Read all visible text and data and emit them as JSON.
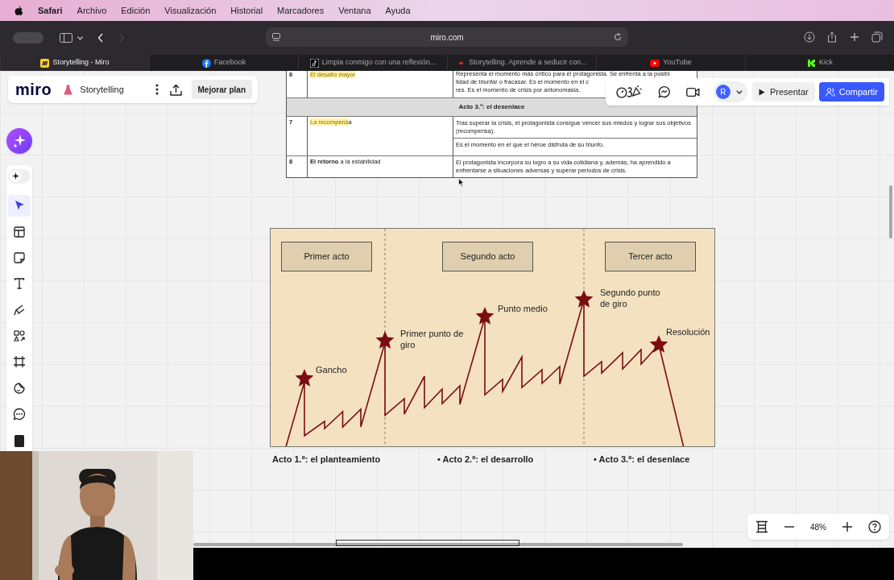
{
  "menu_bar": {
    "app": "Safari",
    "items": [
      "Archivo",
      "Edición",
      "Visualización",
      "Historial",
      "Marcadores",
      "Ventana",
      "Ayuda"
    ]
  },
  "browser": {
    "address": "miro.com",
    "nav": [
      {
        "kind": "back",
        "disabled": false
      },
      {
        "kind": "forward",
        "disabled": true
      }
    ]
  },
  "tabs": [
    {
      "kind": "miro",
      "label": "Storytelling - Miro",
      "selected": true
    },
    {
      "kind": "facebook",
      "label": "Facebook",
      "selected": false
    },
    {
      "kind": "tiktok",
      "label": "Limpia conmigo con una reflexión...",
      "selected": false
    },
    {
      "kind": "red",
      "label": "Storytelling. Aprende a seducir con...",
      "selected": false
    },
    {
      "kind": "youtube",
      "label": "YouTube",
      "selected": false
    },
    {
      "kind": "kick",
      "label": "Kick",
      "selected": false
    }
  ],
  "board": {
    "logo": "miro",
    "title": "Storytelling",
    "upgrade": "Mejorar plan",
    "avatar": "R",
    "present": "Presentar",
    "share": "Compartir",
    "zoom": "48%"
  },
  "tools": [
    {
      "kind": "ai",
      "selected": false
    },
    {
      "kind": "select",
      "selected": true
    },
    {
      "kind": "template",
      "selected": false
    },
    {
      "kind": "sticky",
      "selected": false
    },
    {
      "kind": "text",
      "selected": false
    },
    {
      "kind": "pen",
      "selected": false
    },
    {
      "kind": "shapes",
      "selected": false
    },
    {
      "kind": "frame",
      "selected": false
    },
    {
      "kind": "sticker",
      "selected": false
    },
    {
      "kind": "comment",
      "selected": false
    },
    {
      "kind": "more",
      "selected": false
    }
  ],
  "table": {
    "rows": [
      {
        "kind": "row",
        "number": "6",
        "name": [
          {
            "text": "El desafío mayor",
            "highlight": true
          }
        ],
        "cells": [
          {
            "lines": [
              "Representa el momento más crítico para el protagonista. Se enfrenta a la posibi",
              "lidad de triunfar o fracasar. Es el momento en el c",
              "res. Es el momento de crisis por antonomasia."
            ]
          }
        ]
      },
      {
        "kind": "section",
        "title": "Acto 3.º: el desenlace"
      },
      {
        "kind": "row",
        "number": "7",
        "name": [
          {
            "text": "La recompens",
            "highlight": true
          },
          {
            "text": "a",
            "highlight": false
          }
        ],
        "cells": [
          {
            "lines": [
              "Tras superar la crisis, el protagonista consigue vencer sus miedos y lograr sus objetivos (recompensa)."
            ]
          },
          {
            "lines": [
              "Es el momento en el que el héroe disfruta de su triunfo."
            ]
          }
        ]
      },
      {
        "kind": "row",
        "number": "8",
        "name_rich": "**El retorno** a la estabilidad",
        "cells": [
          {
            "lines": [
              "El protagonista incorpora su logro a su vida cotidiana y, además, ha aprendido a enfrentarse a situaciones adversas y superar periodos de crisis."
            ]
          }
        ]
      }
    ]
  },
  "diagram": {
    "acts": [
      "Primer acto",
      "Segundo acto",
      "Tercer acto"
    ],
    "turning_points": [
      "Gancho",
      "Primer punto de giro",
      "Punto medio",
      "Segundo punto de giro",
      "Resolución"
    ],
    "captions": [
      "Acto 1.º: el planteamiento",
      "• Acto 2.º: el desarrollo",
      "• Acto 3.º: el desenlace"
    ]
  }
}
